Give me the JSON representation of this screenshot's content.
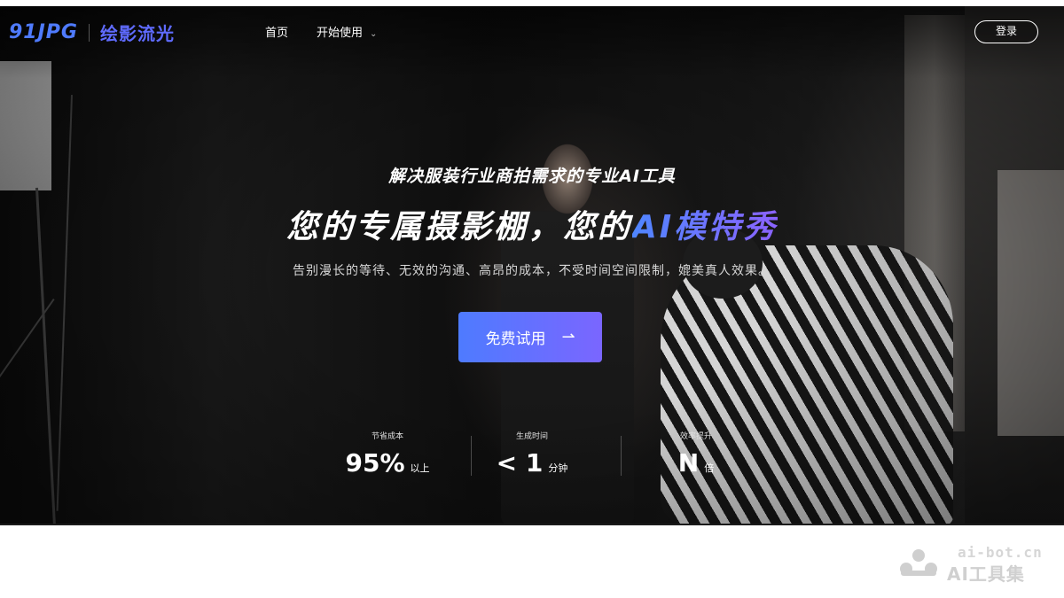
{
  "nav": {
    "logo_mark": "91JPG",
    "logo_cn": "绘影流光",
    "home": "首页",
    "start": "开始使用",
    "login": "登录"
  },
  "hero": {
    "subtitle": "解决服装行业商拍需求的专业AI工具",
    "headline_main": "您的专属摄影棚，您的",
    "headline_accent": "AI模特秀",
    "description": "告别漫长的等待、无效的沟通、高昂的成本，不受时间空间限制，媲美真人效果。",
    "cta": "免费试用"
  },
  "stats": [
    {
      "label": "节省成本",
      "value": "95%",
      "unit": "以上"
    },
    {
      "label": "生成时间",
      "value": "< 1",
      "unit": "分钟"
    },
    {
      "label": "效率提升",
      "value": "N",
      "unit": "倍"
    }
  ],
  "watermark": {
    "url": "ai-bot.cn",
    "name": "AI工具集"
  },
  "colors": {
    "accent_start": "#4e7bff",
    "accent_end": "#7a66ff"
  }
}
